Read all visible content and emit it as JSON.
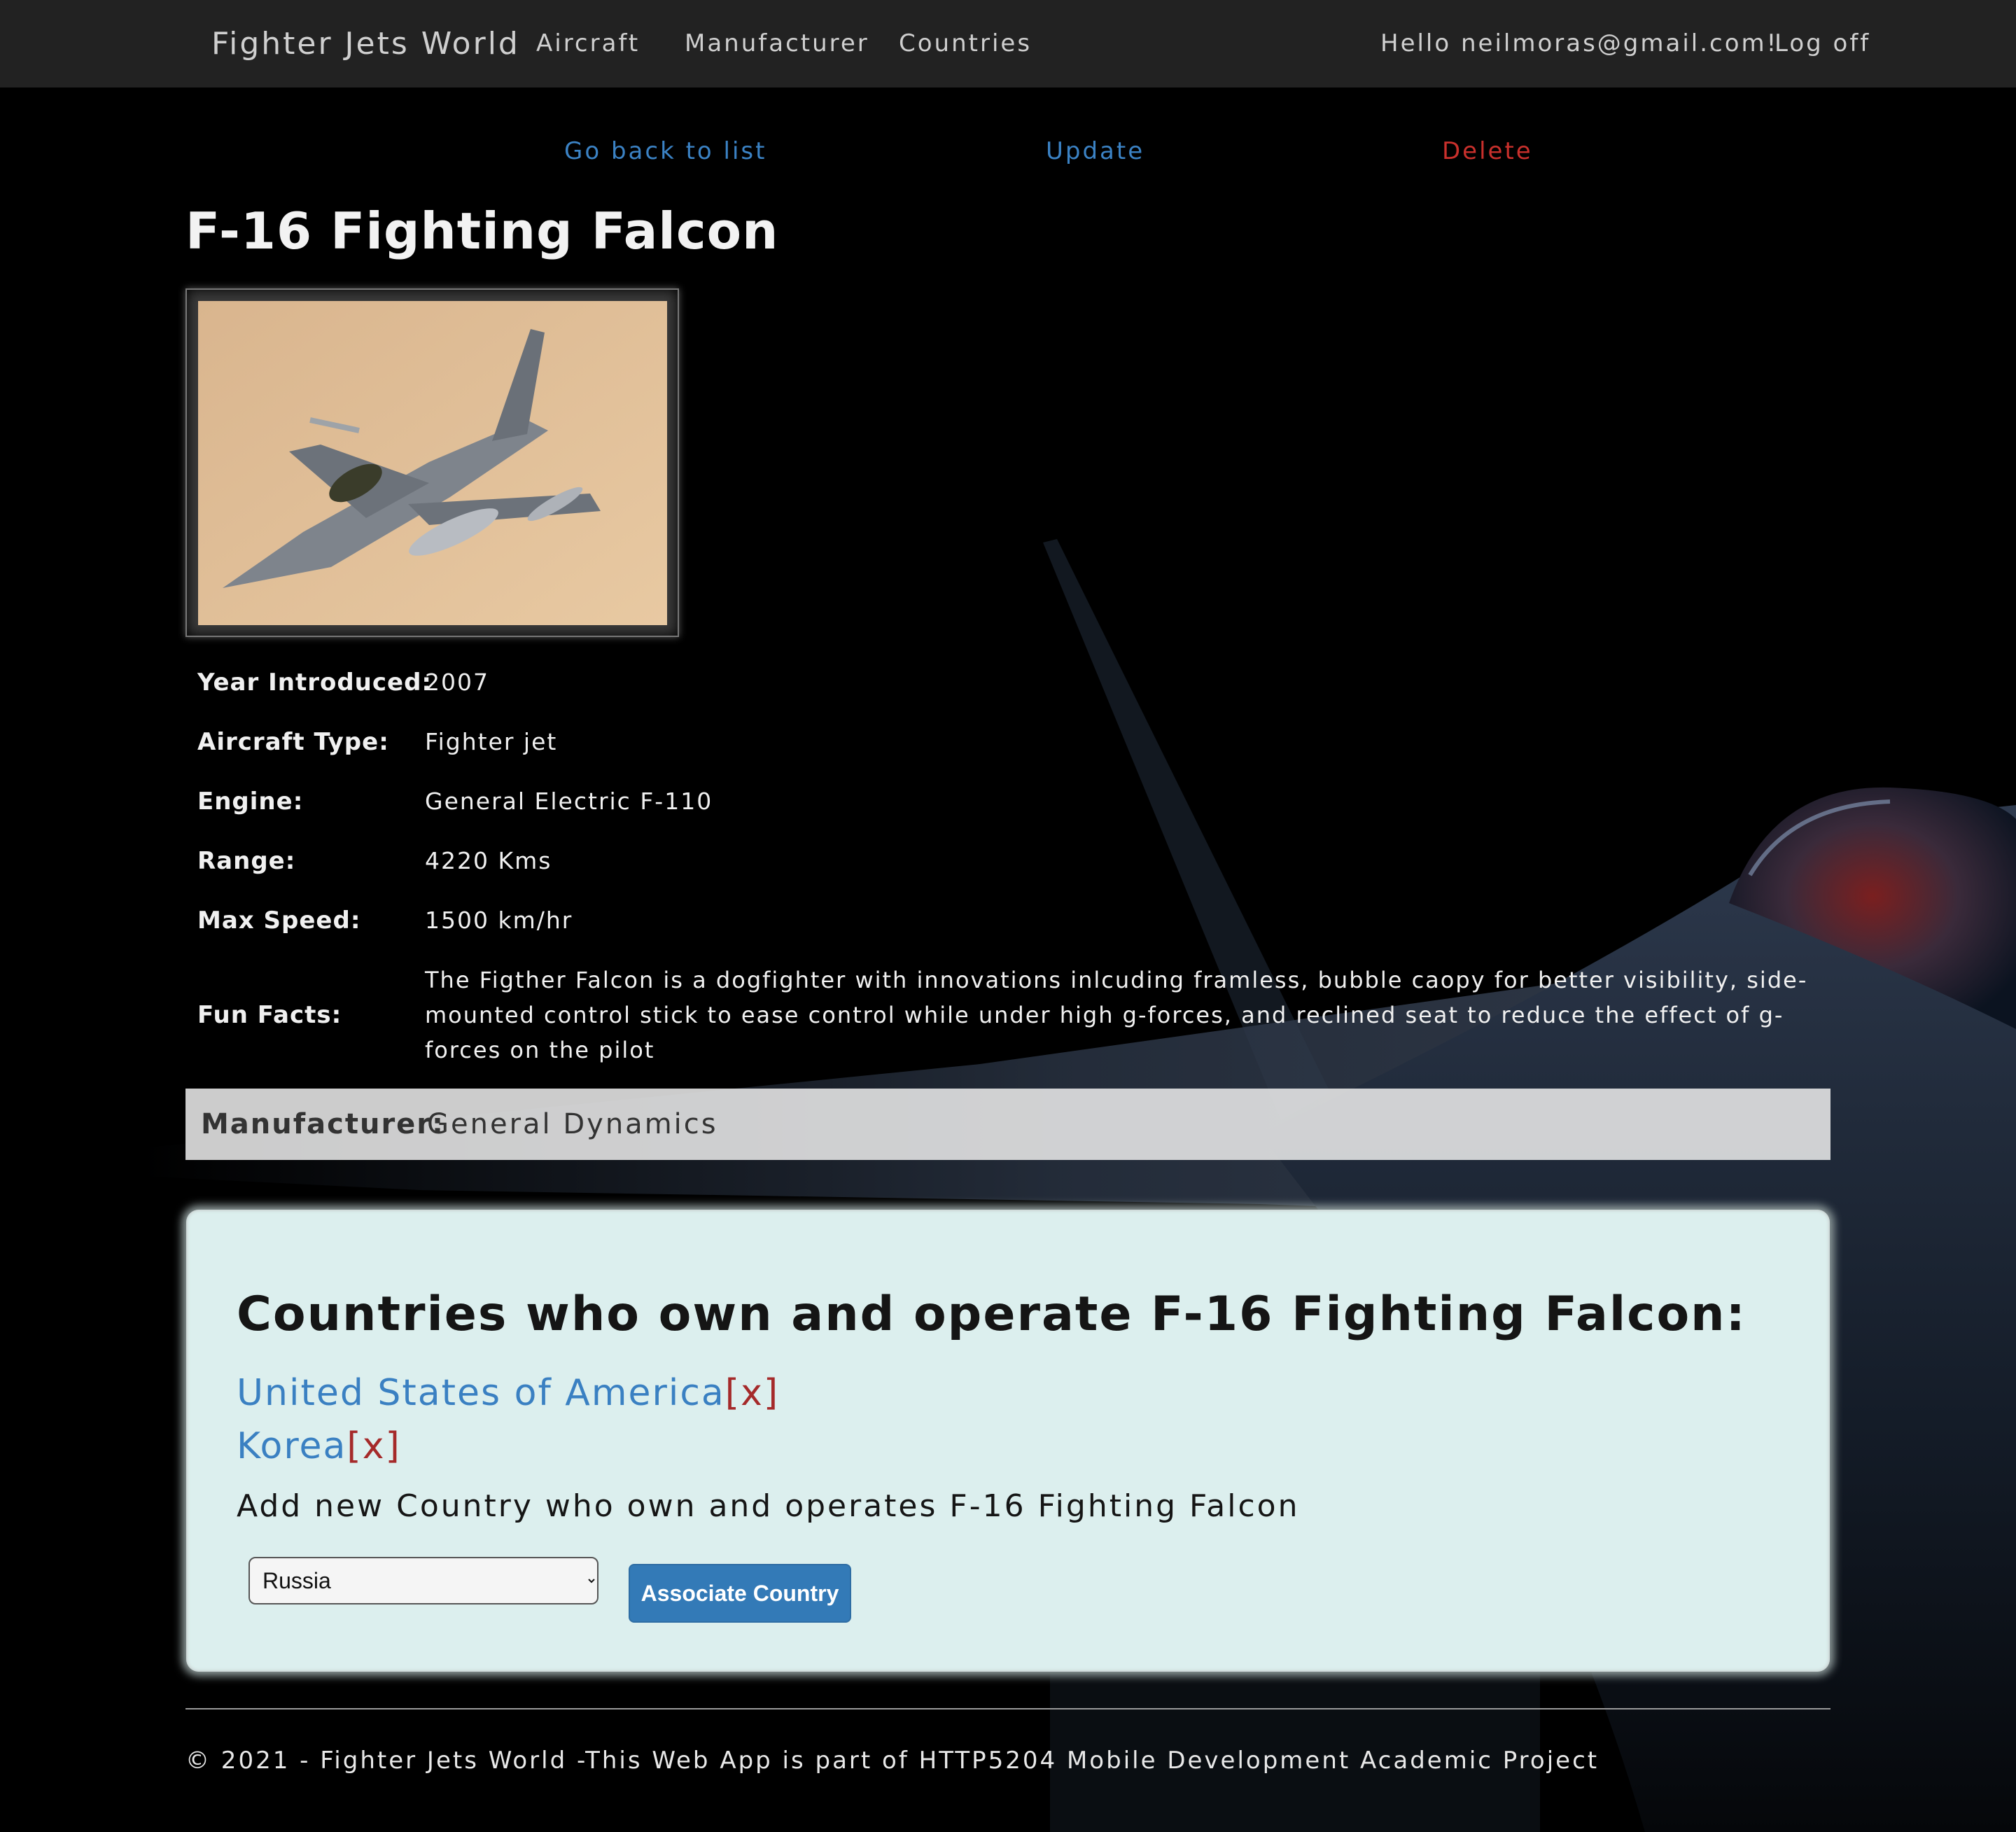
{
  "nav": {
    "brand": "Fighter Jets World",
    "links": [
      "Aircraft",
      "Manufacturer",
      "Countries"
    ],
    "greeting": "Hello neilmoras@gmail.com!",
    "logoff": "Log off"
  },
  "actions": {
    "back": "Go back to list",
    "update": "Update",
    "delete": "Delete"
  },
  "aircraft": {
    "name": "F-16 Fighting Falcon",
    "details": [
      {
        "label": "Year Introduced:",
        "value": "2007"
      },
      {
        "label": "Aircraft Type:",
        "value": "Fighter jet"
      },
      {
        "label": "Engine:",
        "value": "General Electric F-110"
      },
      {
        "label": "Range:",
        "value": "4220 Kms"
      },
      {
        "label": "Max Speed:",
        "value": "1500 km/hr"
      },
      {
        "label": "Fun Facts:",
        "value": "The Figther Falcon is a dogfighter with innovations inlcuding framless, bubble caopy for better visibility, side-mounted control stick to ease control while under high g-forces, and reclined seat to reduce the effect of g-forces on the pilot"
      }
    ],
    "manufacturer_label": "Manufacturer:",
    "manufacturer": "General Dynamics"
  },
  "countries_panel": {
    "title": "Countries who own and operate F-16 Fighting Falcon:",
    "countries": [
      {
        "name": "United States of America",
        "remove": "[x]"
      },
      {
        "name": "Korea",
        "remove": "[x]"
      }
    ],
    "add_label": "Add new Country who own and operates F-16 Fighting Falcon",
    "select_value": "Russia",
    "button": "Associate Country"
  },
  "footer": {
    "text": "© 2021 - Fighter Jets World -This Web App is part of HTTP5204 Mobile Development Academic Project"
  },
  "colors": {
    "navbar": "#222222",
    "link": "#3b82c4",
    "danger": "#c9302c",
    "panel": "#dcefee",
    "button": "#337ab7"
  }
}
